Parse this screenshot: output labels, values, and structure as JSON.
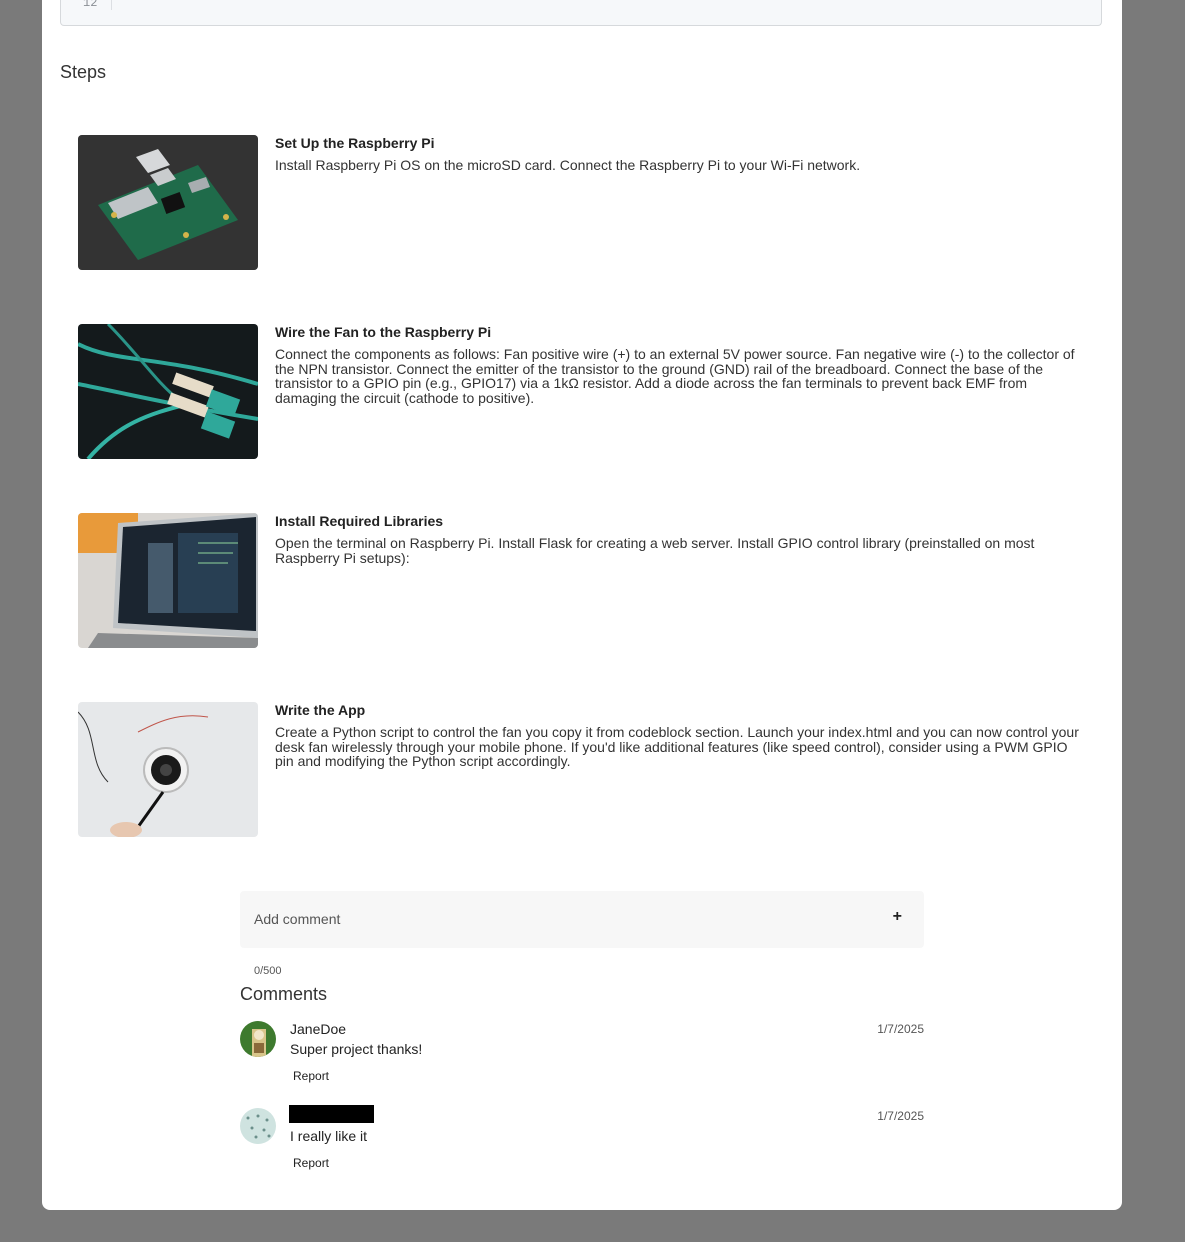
{
  "code": {
    "last_line_number": "12"
  },
  "steps_heading": "Steps",
  "steps": [
    {
      "title": "Set Up the Raspberry Pi",
      "text": "Install Raspberry Pi OS on the microSD card. Connect the Raspberry Pi to your Wi-Fi network.",
      "image": "raspberry-pi-board-image"
    },
    {
      "title": "Wire the Fan to the Raspberry Pi",
      "text": "Connect the components as follows: Fan positive wire (+) to an external 5V power source. Fan negative wire (-) to the collector of the NPN transistor. Connect the emitter of the transistor to the ground (GND) rail of the breadboard. Connect the base of the transistor to a GPIO pin (e.g., GPIO17) via a 1kΩ resistor. Add a diode across the fan terminals to prevent back EMF from damaging the circuit (cathode to positive).",
      "image": "fiber-cables-image"
    },
    {
      "title": "Install Required Libraries",
      "text": "Open the terminal on Raspberry Pi. Install Flask for creating a web server. Install GPIO control library (preinstalled on most Raspberry Pi setups):",
      "image": "laptop-terminal-image"
    },
    {
      "title": "Write the App",
      "text": "Create a Python script to control the fan you copy it from codeblock section. Launch your index.html and you can now control your desk fan wirelessly through your mobile phone. If you'd like additional features (like speed control), consider using a PWM GPIO pin and modifying the Python script accordingly.",
      "image": "fan-wiring-image"
    }
  ],
  "comment_form": {
    "placeholder": "Add comment",
    "add_icon": "+",
    "counter": "0/500"
  },
  "comments_heading": "Comments",
  "comments": [
    {
      "author": "JaneDoe",
      "date": "1/7/2025",
      "text": "Super project thanks!",
      "report_label": "Report"
    },
    {
      "author": "",
      "date": "1/7/2025",
      "text": "I really like it",
      "report_label": "Report"
    }
  ]
}
